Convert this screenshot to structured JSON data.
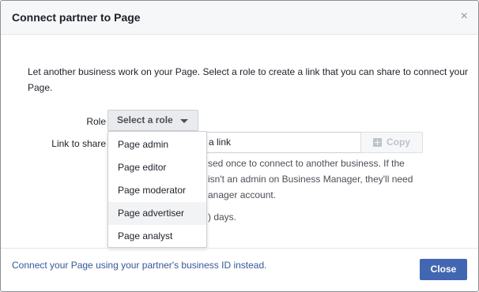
{
  "dialog": {
    "title": "Connect partner to Page",
    "close_glyph": "×"
  },
  "description": "Let another business work on your Page. Select a role to create a link that you can share to connect your Page.",
  "role": {
    "label": "Role",
    "selected": "Select a role"
  },
  "link": {
    "label": "Link to share",
    "value": "a link",
    "copy_label": "Copy"
  },
  "hint_lines": [
    "sed once to connect to another business. If the",
    "isn't an admin on Business Manager, they'll need",
    "anager account."
  ],
  "hint_tail": ") days.",
  "dropdown": {
    "options": [
      "Page admin",
      "Page editor",
      "Page moderator",
      "Page advertiser",
      "Page analyst"
    ],
    "hovered": "Page advertiser"
  },
  "footer": {
    "link_text": "Connect your Page using your partner's business ID instead.",
    "close_label": "Close"
  },
  "colors": {
    "primary_button": "#4267b2",
    "link": "#365899"
  },
  "icons": {
    "close": "close-icon",
    "caret": "chevron-down-icon",
    "copy": "copy-icon"
  }
}
